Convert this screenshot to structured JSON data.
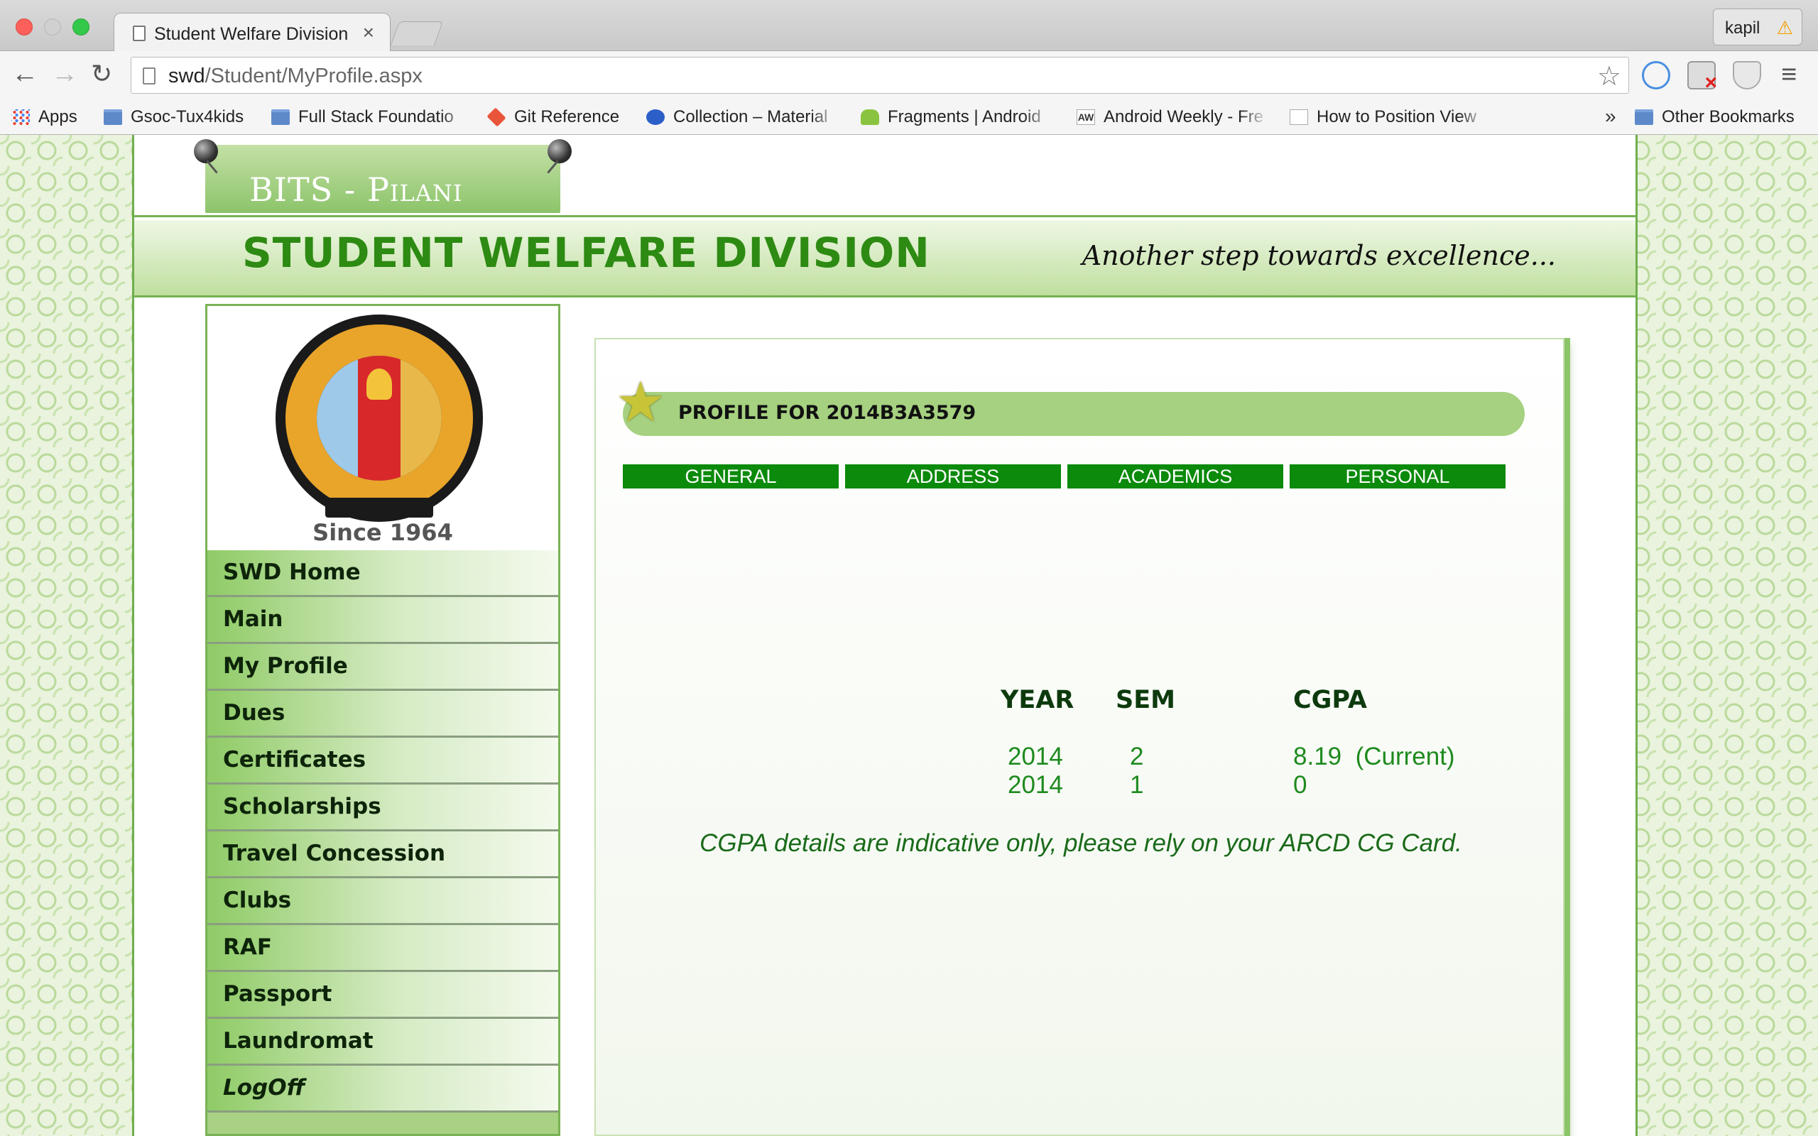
{
  "browser": {
    "tab_title": "Student Welfare Division",
    "tab_close": "×",
    "profile_name": "kapil",
    "url_host": "swd",
    "url_path": "/Student/MyProfile.aspx",
    "bookmarks": [
      {
        "label": "Apps",
        "icon": "apps-icon"
      },
      {
        "label": "Gsoc-Tux4kids",
        "icon": "folder-icon"
      },
      {
        "label": "Full Stack Foundatio",
        "icon": "folder-icon"
      },
      {
        "label": "Git Reference",
        "icon": "git-icon"
      },
      {
        "label": "Collection – Material",
        "icon": "collection-icon"
      },
      {
        "label": "Fragments | Android",
        "icon": "android-icon"
      },
      {
        "label": "Android Weekly - Fre",
        "icon": "aw-icon"
      },
      {
        "label": "How to Position View",
        "icon": "page-icon"
      }
    ],
    "bookmarks_overflow": "»",
    "other_bookmarks": "Other Bookmarks"
  },
  "site": {
    "brand": "BITS - Pilani",
    "title": "STUDENT WELFARE DIVISION",
    "tagline": "Another step towards excellence...",
    "logo_since": "Since 1964"
  },
  "sidebar": {
    "items": [
      {
        "label": "SWD Home"
      },
      {
        "label": "Main"
      },
      {
        "label": "My Profile"
      },
      {
        "label": "Dues"
      },
      {
        "label": "Certificates"
      },
      {
        "label": "Scholarships"
      },
      {
        "label": "Travel Concession"
      },
      {
        "label": "Clubs"
      },
      {
        "label": "RAF"
      },
      {
        "label": "Passport"
      },
      {
        "label": "Laundromat"
      },
      {
        "label": "LogOff"
      }
    ]
  },
  "profile": {
    "heading": "PROFILE FOR 2014B3A3579",
    "tabs": [
      {
        "label": "GENERAL"
      },
      {
        "label": "ADDRESS"
      },
      {
        "label": "ACADEMICS"
      },
      {
        "label": "PERSONAL"
      }
    ],
    "grades": {
      "headers": {
        "year": "YEAR",
        "sem": "SEM",
        "cgpa": "CGPA"
      },
      "rows": [
        {
          "year": "2014",
          "sem": "2",
          "cgpa": "8.19  (Current)"
        },
        {
          "year": "2014",
          "sem": "1",
          "cgpa": "0"
        }
      ]
    },
    "note": "CGPA details are indicative only, please rely on your ARCD CG Card."
  }
}
